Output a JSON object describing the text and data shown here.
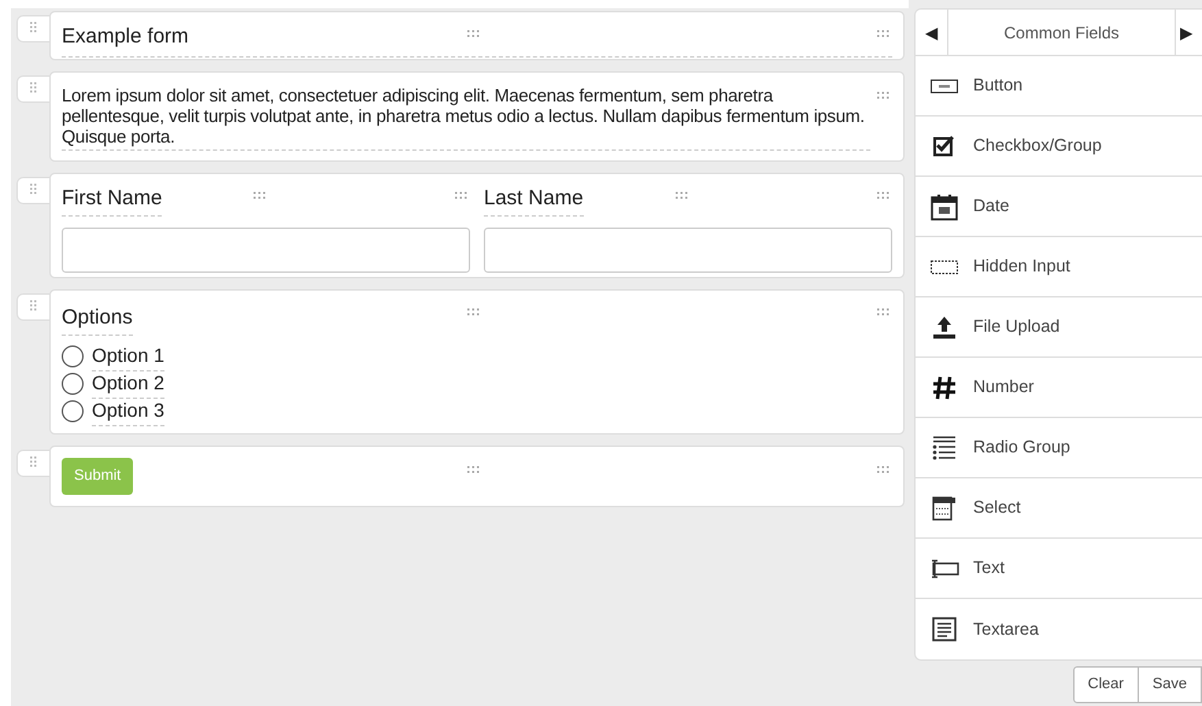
{
  "form": {
    "title": "Example form",
    "paragraph": "Lorem ipsum dolor sit amet, consectetuer adipiscing elit. Maecenas fermentum, sem pharetra pellentesque, velit turpis volutpat ante, in pharetra metus odio a lectus. Nullam dapibus fermentum ipsum. Quisque porta.",
    "fields": [
      {
        "label": "First Name"
      },
      {
        "label": "Last Name"
      }
    ],
    "radio_group": {
      "label": "Options",
      "options": [
        {
          "label": "Option 1",
          "selected": false
        },
        {
          "label": "Option 2",
          "selected": false
        },
        {
          "label": "Option 3",
          "selected": false
        }
      ]
    },
    "submit": "Submit"
  },
  "panel": {
    "title": "Common Fields",
    "prev": "◀",
    "next": "▶",
    "items": [
      {
        "label": "Button"
      },
      {
        "label": "Checkbox/Group"
      },
      {
        "label": "Date"
      },
      {
        "label": "Hidden Input"
      },
      {
        "label": "File Upload"
      },
      {
        "label": "Number"
      },
      {
        "label": "Radio Group"
      },
      {
        "label": "Select"
      },
      {
        "label": "Text"
      },
      {
        "label": "Textarea"
      }
    ]
  },
  "actions": [
    "Clear",
    "Save"
  ]
}
